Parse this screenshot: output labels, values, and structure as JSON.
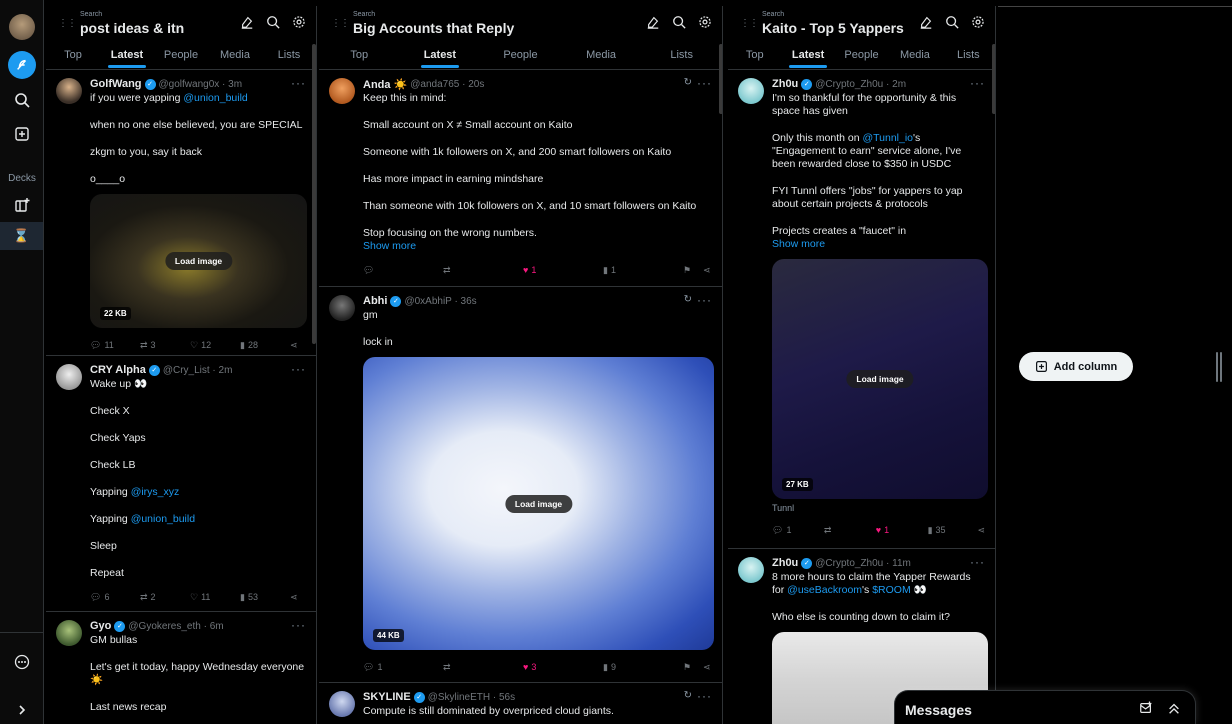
{
  "sidebar": {
    "decks_label": "Decks"
  },
  "colors": {
    "accent": "#1d9bf0",
    "like": "#f91880",
    "background": "#000000",
    "muted": "#71767b"
  },
  "columns": [
    {
      "search_label": "Search",
      "title": "post ideas & itn",
      "tabs": [
        "Top",
        "Latest",
        "People",
        "Media",
        "Lists"
      ],
      "active_tab": "Latest",
      "tweets": [
        {
          "name": "GolfWang",
          "handle": "@golfwang0x · 3m",
          "lines": [
            "if you were yapping ",
            "@union_build",
            "when no one else believed, you are SPECIAL",
            "zkgm to you, say it back",
            "o____o"
          ],
          "media_size": "22 KB",
          "load_label": "Load image",
          "stats": {
            "reply": "11",
            "retweet": "3",
            "like": "12",
            "views": "28"
          }
        },
        {
          "name": "CRY Alpha",
          "handle": "@Cry_List · 2m",
          "lines": [
            "Wake up 👀",
            "Check X",
            "Check Yaps",
            "Check LB",
            "Yapping ",
            "@irys_xyz",
            "Yapping ",
            "@union_build",
            "Sleep",
            "Repeat"
          ],
          "stats": {
            "reply": "6",
            "retweet": "2",
            "like": "11",
            "views": "53"
          }
        },
        {
          "name": "Gyo",
          "handle": "@Gyokeres_eth · 6m",
          "lines": [
            "GM bullas",
            "Let's get it today, happy Wednesday everyone",
            "☀️",
            "Last news recap"
          ]
        }
      ]
    },
    {
      "search_label": "Search",
      "title": "Big Accounts that Reply",
      "tabs": [
        "Top",
        "Latest",
        "People",
        "Media",
        "Lists"
      ],
      "active_tab": "Latest",
      "tweets": [
        {
          "name": "Anda ☀️",
          "handle": "@anda765 · 20s",
          "lines": [
            "Keep this in mind:",
            "Small account on X ≠ Small account on Kaito",
            "Someone with 1k followers on X, and 200 smart followers on Kaito",
            "Has more impact in earning mindshare",
            "Than someone with 10k followers on X, and 10 smart followers on Kaito",
            "Stop focusing on the wrong numbers."
          ],
          "show_more": "Show more",
          "stats": {
            "like": "1",
            "views": "1"
          }
        },
        {
          "name": "Abhi",
          "handle": "@0xAbhiP · 36s",
          "lines": [
            "gm",
            "lock in"
          ],
          "media_size": "44 KB",
          "load_label": "Load image",
          "stats": {
            "reply": "1",
            "like": "3",
            "views": "9"
          }
        },
        {
          "name": "SKYLINE",
          "handle": "@SkylineETH · 56s",
          "lines": [
            "Compute is still dominated by overpriced cloud giants."
          ]
        }
      ]
    },
    {
      "search_label": "Search",
      "title": "Kaito - Top 5 Yappers",
      "tabs": [
        "Top",
        "Latest",
        "People",
        "Media",
        "Lists"
      ],
      "active_tab": "Latest",
      "tweets": [
        {
          "name": "Zh0u",
          "handle": "@Crypto_Zh0u · 2m",
          "lines": [
            "I'm so thankful for the opportunity & this space has given",
            "Only this month on ",
            "@Tunnl_io",
            "'s \"Engagement to earn\" service alone, I've been rewarded close to $350 in USDC",
            "FYI Tunnl offers \"jobs\" for yappers to yap about certain projects & protocols",
            "Projects creates a \"faucet\" in"
          ],
          "show_more": "Show more",
          "media_size": "27 KB",
          "load_label": "Load image",
          "caption": "Tunnl",
          "stats": {
            "reply": "1",
            "like": "1",
            "views": "35"
          }
        },
        {
          "name": "Zh0u",
          "handle": "@Crypto_Zh0u · 11m",
          "lines": [
            "8 more hours to claim the Yapper Rewards for ",
            "@useBackroom",
            "'s ",
            "$ROOM",
            " 👀",
            "Who else is counting down to claim it?"
          ]
        }
      ]
    }
  ],
  "add_column_label": "Add column",
  "messages": {
    "title": "Messages"
  }
}
